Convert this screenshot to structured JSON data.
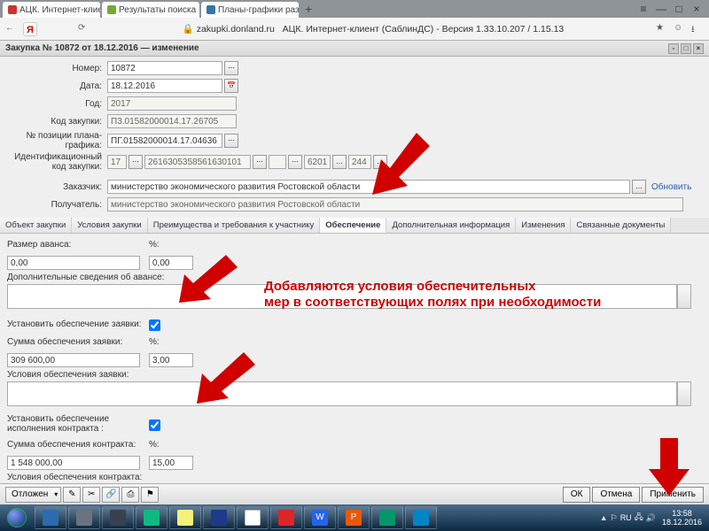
{
  "browser": {
    "tabs": [
      {
        "label": "АЦК. Интернет-клиент (",
        "active": true
      },
      {
        "label": "Результаты поиска",
        "active": false
      },
      {
        "label": "Планы-графики размещен…",
        "active": false
      }
    ],
    "yandex_logo": "Я",
    "address_host": "zakupki.donland.ru",
    "address_title": "АЦК. Интернет-клиент (СаблинДС) - Версия 1.33.10.207 / 1.15.13"
  },
  "window": {
    "title": "Закупка № 10872 от 18.12.2016 — изменение"
  },
  "form": {
    "number_label": "Номер:",
    "number_value": "10872",
    "date_label": "Дата:",
    "date_value": "18.12.2016",
    "year_label": "Год:",
    "year_value": "2017",
    "code_label": "Код закупки:",
    "code_value": "П3.01582000014.17.26705",
    "pos_label": "№ позиции плана-графика:",
    "pos_value": "ПГ.01582000014.17.04636",
    "ident_label": "Идентификационный код закупки:",
    "ident_v1": "17",
    "ident_v2": "2616305358561630101",
    "ident_v3": "6201",
    "ident_v4": "244",
    "customer_label": "Заказчик:",
    "customer_value": "министерство экономического развития Ростовской области",
    "receiver_label": "Получатель:",
    "receiver_value": "министерство экономического развития Ростовской области",
    "refresh": "Обновить"
  },
  "tabs": [
    "Объект закупки",
    "Условия закупки",
    "Преимущества и требования к участнику",
    "Обеспечение",
    "Дополнительная информация",
    "Изменения",
    "Связанные документы"
  ],
  "panel": {
    "avans_size_label": "Размер аванса:",
    "avans_size_value": "0,00",
    "pct_label": "%:",
    "avans_pct_value": "0,00",
    "avans_extra_label": "Дополнительные сведения об авансе:",
    "app_secure_set_label": "Установить обеспечение заявки:",
    "app_secure_sum_label": "Сумма обеспечения заявки:",
    "app_secure_sum_value": "309 600,00",
    "app_secure_pct_value": "3,00",
    "app_secure_cond_label": "Условия обеспечения заявки:",
    "contract_secure_set_label": "Установить обеспечение исполнения контракта :",
    "contract_secure_sum_label": "Сумма обеспечения контракта:",
    "contract_secure_sum_value": "1 548 000,00",
    "contract_secure_pct_value": "15,00",
    "contract_secure_cond_label": "Условия обеспечения контракта:"
  },
  "footer": {
    "postpone": "Отложен",
    "ok": "ОК",
    "cancel": "Отмена",
    "apply": "Применить"
  },
  "taskbar": {
    "lang": "RU",
    "time": "13:58",
    "date": "18.12.2016"
  },
  "annotation": {
    "line1": "Добавляются условия обеспечительных",
    "line2": "мер в соответствующих полях при необходимости"
  }
}
